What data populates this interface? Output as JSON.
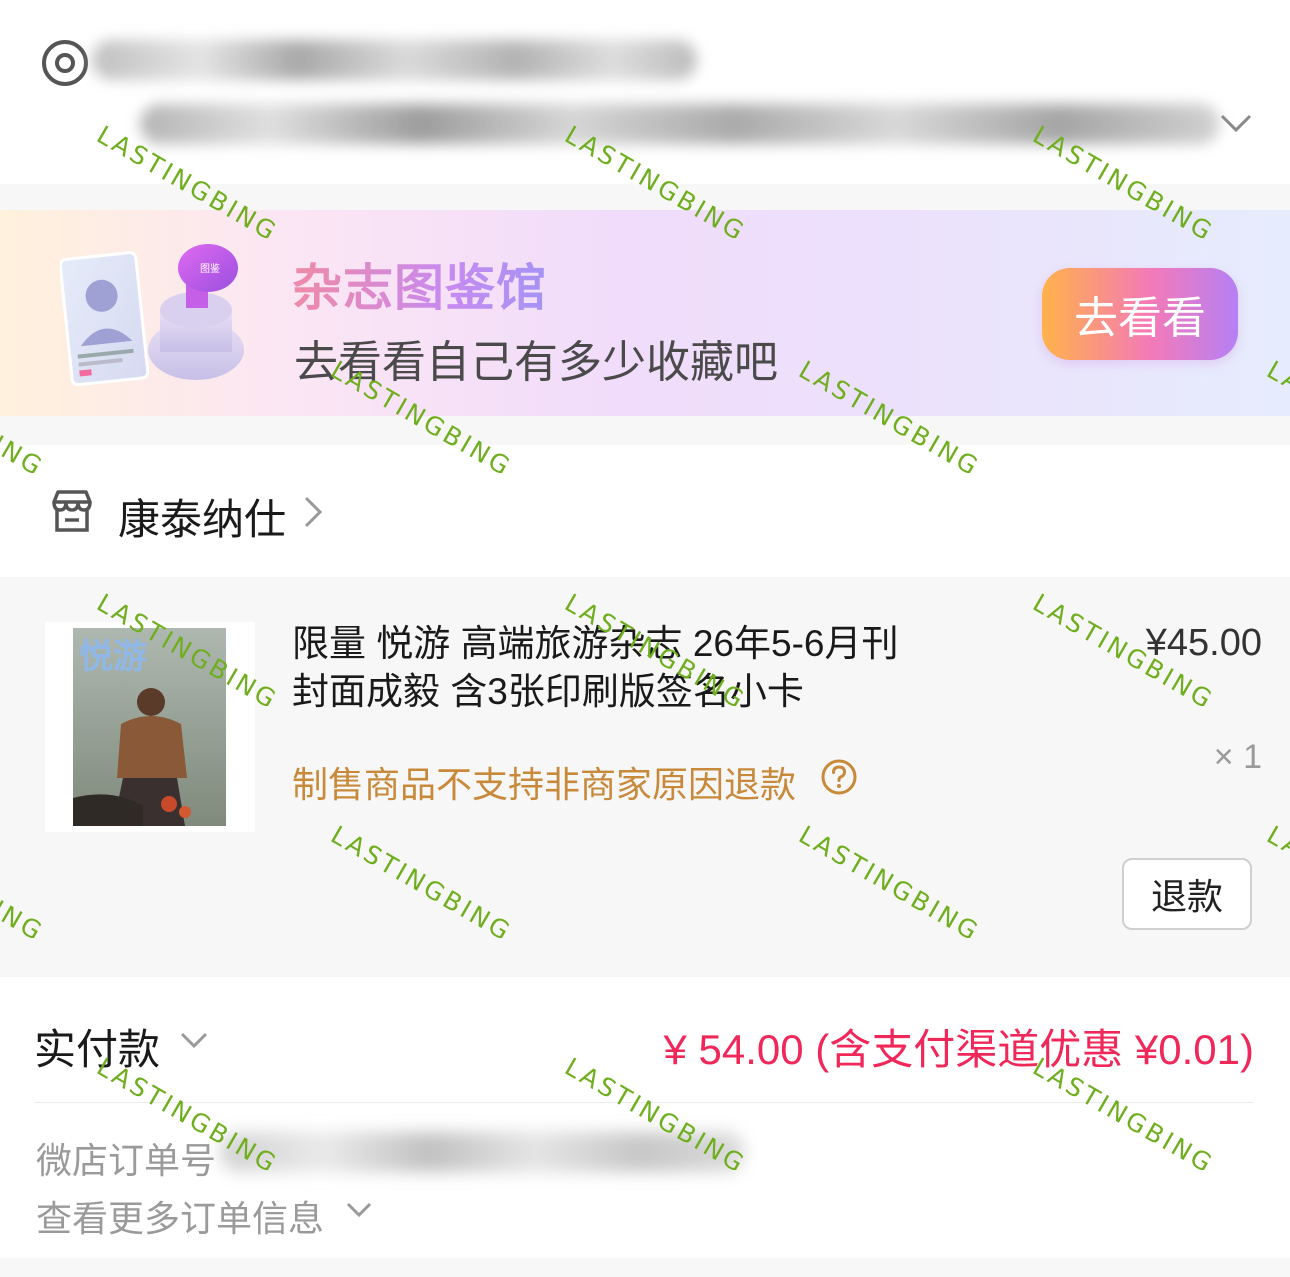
{
  "banner": {
    "title": "杂志图鉴馆",
    "subtitle": "去看看自己有多少收藏吧",
    "button_label": "去看看",
    "stamp_text": "图鉴"
  },
  "shop": {
    "name": "康泰纳仕"
  },
  "product": {
    "name": "限量 悦游 高端旅游杂志 26年5-6月刊 封面成毅 含3张印刷版签名小卡",
    "price": "¥45.00",
    "quantity": "× 1",
    "notice": "制售商品不支持非商家原因退款",
    "refund_label": "退款",
    "thumb_text": "悦游"
  },
  "payment": {
    "label": "实付款",
    "amount": "¥ 54.00 (含支付渠道优惠 ¥0.01)"
  },
  "order": {
    "number_label": "微店订单号",
    "more_label": "查看更多订单信息"
  },
  "watermark": {
    "text": "LASTINGBING",
    "color": "#6fae1e"
  },
  "colors": {
    "accent_red": "#f0285a",
    "notice_orange": "#c8893a",
    "section_gray": "#f7f7f7"
  },
  "icons": {
    "location": "location-pin-icon",
    "expand": "chevron-down-icon",
    "shop": "shop-icon",
    "forward": "chevron-right-icon",
    "help": "question-circle-icon"
  }
}
